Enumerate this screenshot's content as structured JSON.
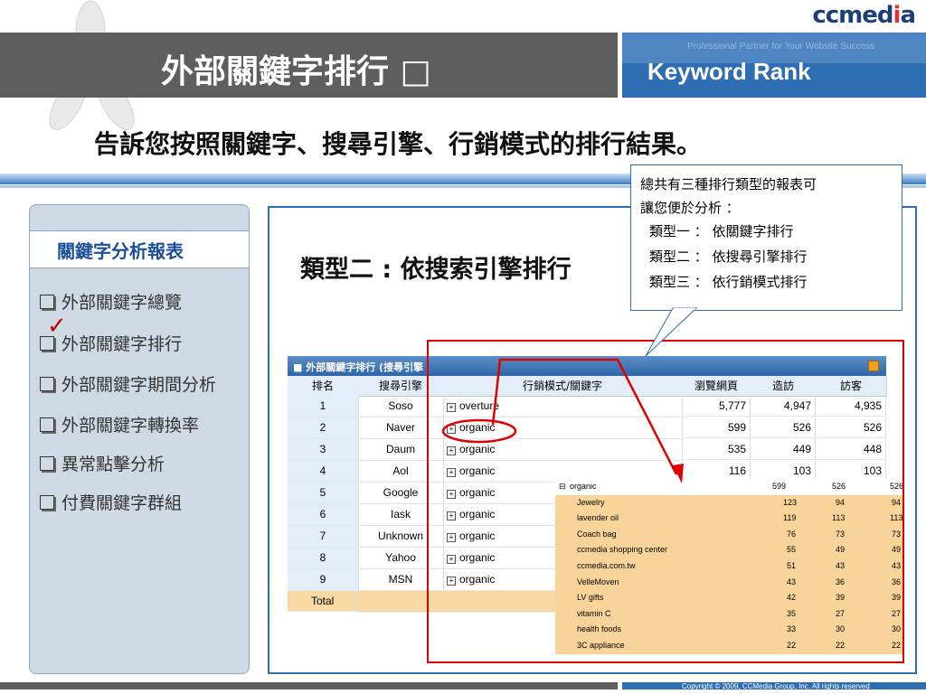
{
  "header": {
    "title_zh": "外部關鍵字排行 □",
    "title_en": "Keyword Rank",
    "logo_prefix": "ccmed",
    "logo_i": "i",
    "logo_suffix": "a",
    "tagline": "Professional Partner for Your Website Success"
  },
  "subtitle": "告訴您按照關鍵字、搜尋引擎、行銷模式的排行結果。",
  "sidebar": {
    "title": "關鍵字分析報表",
    "items": [
      {
        "label": "外部關鍵字總覽"
      },
      {
        "label": "外部關鍵字排行"
      },
      {
        "label": "外部關鍵字期間分析"
      },
      {
        "label": "外部關鍵字轉換率"
      },
      {
        "label": "異常點擊分析"
      },
      {
        "label": "付費關鍵字群組"
      }
    ],
    "checkmark": "✓"
  },
  "main": {
    "type_label": "類型二 : 依搜索引擎排行"
  },
  "callout": {
    "lines": [
      "總共有三種排行類型的報表可",
      "讓您便於分析 ：",
      "類型一 ： 依關鍵字排行",
      "類型二 ： 依搜尋引擎排行",
      "類型三 ： 依行銷模式排行"
    ]
  },
  "table": {
    "title": "■ 外部關鍵字排行 (搜尋引擎",
    "columns": [
      "排名",
      "搜尋引擎",
      "行銷模式/關鍵字",
      "瀏覽網頁",
      "造訪",
      "訪客"
    ],
    "rows": [
      {
        "rank": "1",
        "engine": "Soso",
        "mode": "overture",
        "pv": "5,777",
        "visits": "4,947",
        "visitors": "4,935"
      },
      {
        "rank": "2",
        "engine": "Naver",
        "mode": "organic",
        "pv": "599",
        "visits": "526",
        "visitors": "526"
      },
      {
        "rank": "3",
        "engine": "Daum",
        "mode": "organic",
        "pv": "535",
        "visits": "449",
        "visitors": "448"
      },
      {
        "rank": "4",
        "engine": "Aol",
        "mode": "organic",
        "pv": "116",
        "visits": "103",
        "visitors": "103"
      },
      {
        "rank": "5",
        "engine": "Google",
        "mode": "organic"
      },
      {
        "rank": "6",
        "engine": "Iask",
        "mode": "organic"
      },
      {
        "rank": "7",
        "engine": "Unknown",
        "mode": "organic"
      },
      {
        "rank": "8",
        "engine": "Yahoo",
        "mode": "organic"
      },
      {
        "rank": "9",
        "engine": "MSN",
        "mode": "organic"
      }
    ],
    "total_label": "Total"
  },
  "popout": {
    "header": {
      "label": "organic",
      "pv": "599",
      "visits": "526",
      "visitors": "526"
    },
    "rows": [
      {
        "kw": "Jewelry",
        "pv": "123",
        "visits": "94",
        "visitors": "94"
      },
      {
        "kw": "lavender oil",
        "pv": "119",
        "visits": "113",
        "visitors": "113"
      },
      {
        "kw": "Coach bag",
        "pv": "76",
        "visits": "73",
        "visitors": "73"
      },
      {
        "kw": "ccmedia shopping center",
        "pv": "55",
        "visits": "49",
        "visitors": "49"
      },
      {
        "kw": "ccmedia.com.tw",
        "pv": "51",
        "visits": "43",
        "visitors": "43"
      },
      {
        "kw": "VelleMoven",
        "pv": "43",
        "visits": "36",
        "visitors": "36"
      },
      {
        "kw": "LV gifts",
        "pv": "42",
        "visits": "39",
        "visitors": "39"
      },
      {
        "kw": "vitamin C",
        "pv": "35",
        "visits": "27",
        "visitors": "27"
      },
      {
        "kw": "health foods",
        "pv": "33",
        "visits": "30",
        "visitors": "30"
      },
      {
        "kw": "3C appliance",
        "pv": "22",
        "visits": "22",
        "visitors": "22"
      }
    ]
  },
  "footer": {
    "copyright": "Copyright © 2009, CCMedia Group, Inc. All rights reserved"
  },
  "colors": {
    "header_gray": "#5e5e5e",
    "header_blue": "#2f6db2",
    "highlight_red": "#e00000",
    "row_orange": "#f9d49a"
  }
}
